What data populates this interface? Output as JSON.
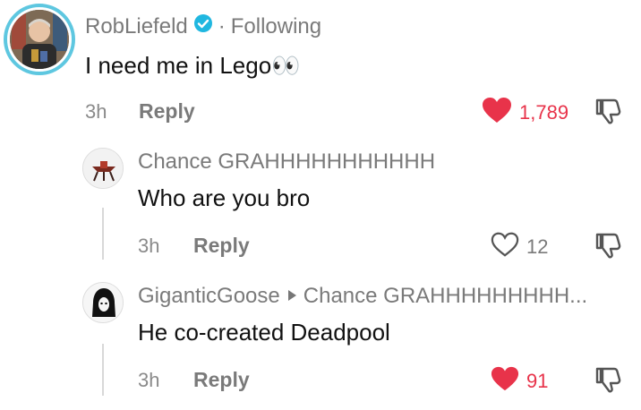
{
  "comments": [
    {
      "username": "RobLiefeld",
      "follow_status": "Following",
      "text": "I need me in Lego",
      "emoji": "👀",
      "time": "3h",
      "reply_label": "Reply",
      "likes": "1,789",
      "liked": true
    },
    {
      "username": "Chance GRAHHHHHHHHHHH",
      "text": "Who are you bro",
      "time": "3h",
      "reply_label": "Reply",
      "likes": "12",
      "liked": false
    },
    {
      "username": "GiganticGoose",
      "reply_to": "Chance GRAHHHHHHHHH...",
      "text": "He co-created Deadpool",
      "time": "3h",
      "reply_label": "Reply",
      "likes": "91",
      "liked": true
    }
  ],
  "colors": {
    "liked_heart": "#e8334a",
    "verified": "#20b7e0",
    "muted_text": "#7a7a7a"
  }
}
